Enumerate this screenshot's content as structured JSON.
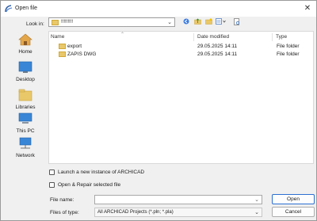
{
  "window": {
    "title": "Open file"
  },
  "toolbar": {
    "look_in_label": "Look in:",
    "look_in_value": "!!!!!!!!!"
  },
  "places": [
    {
      "label": "Home",
      "icon": "home-icon"
    },
    {
      "label": "Desktop",
      "icon": "desktop-icon"
    },
    {
      "label": "Libraries",
      "icon": "libraries-icon"
    },
    {
      "label": "This PC",
      "icon": "computer-icon"
    },
    {
      "label": "Network",
      "icon": "network-icon"
    }
  ],
  "file_list": {
    "columns": [
      "Name",
      "Date modified",
      "Type"
    ],
    "rows": [
      {
        "name": "export",
        "date": "29.05.2025 14:11",
        "type": "File folder"
      },
      {
        "name": "ZAPIS DWG",
        "date": "29.05.2025 14:11",
        "type": "File folder"
      }
    ]
  },
  "options": {
    "launch_new_instance": "Launch a new instance of ARCHICAD",
    "open_repair": "Open & Repair selected file"
  },
  "file_name": {
    "label": "File name:",
    "value": ""
  },
  "file_type": {
    "label": "Files of type:",
    "value": "All ARCHICAD Projects (*.pln; *.pla)"
  },
  "buttons": {
    "open": "Open",
    "cancel": "Cancel"
  },
  "colors": {
    "accent": "#2b6fd1",
    "folder": "#e9c86a"
  }
}
